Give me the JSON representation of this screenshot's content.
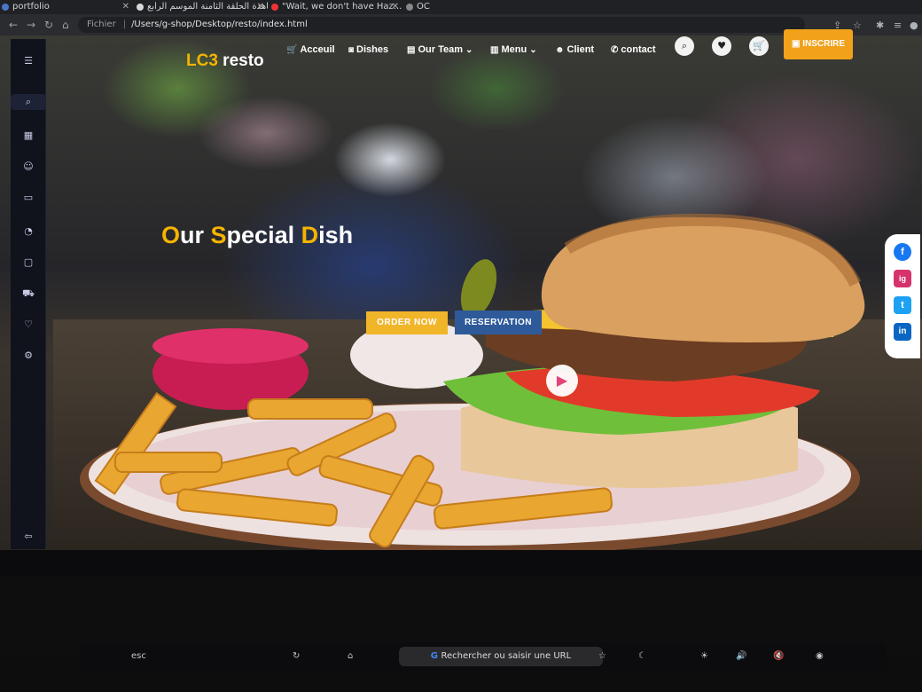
{
  "browser": {
    "tabs": [
      {
        "title": "portfolio",
        "color": "#4a76c9"
      },
      {
        "title": "مشاهدة الحلقة الثامنة الموسم الرابع",
        "color": "#d9d9d9"
      },
      {
        "title": "\"Wait, we don't have Haz...",
        "color": "#e33"
      },
      {
        "title": "OC",
        "color": "#888"
      }
    ],
    "address": {
      "scheme_label": "Fichier",
      "url": "/Users/g-shop/Desktop/resto/index.html"
    }
  },
  "site": {
    "logo": {
      "accent": "LC3",
      "rest": " resto"
    },
    "nav": [
      {
        "label": "Acceuil",
        "icon": "cart-icon"
      },
      {
        "label": "Dishes",
        "icon": "chat-icon"
      },
      {
        "label": "Our Team",
        "icon": "shop-icon"
      },
      {
        "label": "Menu",
        "icon": "document-icon"
      },
      {
        "label": "Client",
        "icon": "user-add-icon"
      },
      {
        "label": "contact",
        "icon": "phone-icon"
      }
    ],
    "inscrire_label": "INSCRIRE",
    "hero": {
      "title_parts": [
        "O",
        "ur ",
        "S",
        "pecial ",
        "D",
        "ish"
      ],
      "order_label": "ORDER NOW",
      "reservation_label": "RESERVATION"
    },
    "social": [
      "f",
      "ig",
      "t",
      "in"
    ],
    "colors": {
      "accent": "#f5b400",
      "reservation": "#2e5a9a",
      "inscrire": "#f1a21a"
    }
  },
  "keyboard": {
    "esc": "esc",
    "search": "Rechercher ou saisir une URL"
  }
}
